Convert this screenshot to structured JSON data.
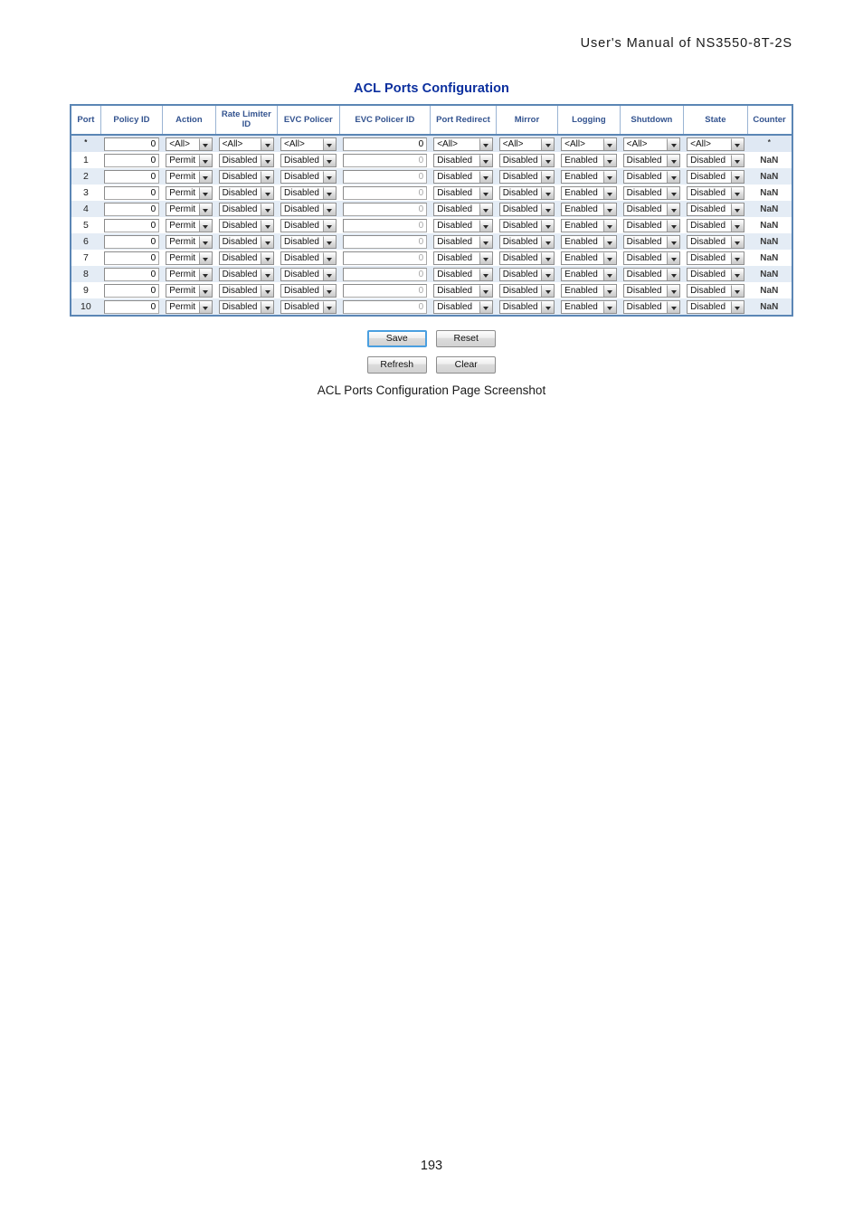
{
  "document": {
    "running_header": "User's Manual of NS3550-8T-2S",
    "page_number": "193"
  },
  "screenshot": {
    "title": "ACL Ports Configuration",
    "caption": "ACL Ports Configuration Page Screenshot",
    "colors": {
      "title_blue": "#0b2f9e",
      "table_border_blue": "#5b86b5",
      "header_text_blue": "#33538f",
      "row_alt_blue": "#e4ecf5",
      "star_row_blue": "#dfe8f3",
      "focus_ring_blue": "#4a9fe0"
    },
    "table": {
      "columns": [
        "Port",
        "Policy ID",
        "Action",
        "Rate Limiter ID",
        "EVC Policer",
        "EVC Policer ID",
        "Port Redirect",
        "Mirror",
        "Logging",
        "Shutdown",
        "State",
        "Counter"
      ],
      "rows": [
        {
          "port": "*",
          "policy_id": "0",
          "action": "<All>",
          "rate_limiter_id": "<All>",
          "evc_policer": "<All>",
          "evc_policer_id": "0",
          "port_redirect": "<All>",
          "mirror": "<All>",
          "logging": "<All>",
          "shutdown": "<All>",
          "state": "<All>",
          "counter": "*"
        },
        {
          "port": "1",
          "policy_id": "0",
          "action": "Permit",
          "rate_limiter_id": "Disabled",
          "evc_policer": "Disabled",
          "evc_policer_id": "0",
          "port_redirect": "Disabled",
          "mirror": "Disabled",
          "logging": "Enabled",
          "shutdown": "Disabled",
          "state": "Disabled",
          "counter": "NaN"
        },
        {
          "port": "2",
          "policy_id": "0",
          "action": "Permit",
          "rate_limiter_id": "Disabled",
          "evc_policer": "Disabled",
          "evc_policer_id": "0",
          "port_redirect": "Disabled",
          "mirror": "Disabled",
          "logging": "Enabled",
          "shutdown": "Disabled",
          "state": "Disabled",
          "counter": "NaN"
        },
        {
          "port": "3",
          "policy_id": "0",
          "action": "Permit",
          "rate_limiter_id": "Disabled",
          "evc_policer": "Disabled",
          "evc_policer_id": "0",
          "port_redirect": "Disabled",
          "mirror": "Disabled",
          "logging": "Enabled",
          "shutdown": "Disabled",
          "state": "Disabled",
          "counter": "NaN"
        },
        {
          "port": "4",
          "policy_id": "0",
          "action": "Permit",
          "rate_limiter_id": "Disabled",
          "evc_policer": "Disabled",
          "evc_policer_id": "0",
          "port_redirect": "Disabled",
          "mirror": "Disabled",
          "logging": "Enabled",
          "shutdown": "Disabled",
          "state": "Disabled",
          "counter": "NaN"
        },
        {
          "port": "5",
          "policy_id": "0",
          "action": "Permit",
          "rate_limiter_id": "Disabled",
          "evc_policer": "Disabled",
          "evc_policer_id": "0",
          "port_redirect": "Disabled",
          "mirror": "Disabled",
          "logging": "Enabled",
          "shutdown": "Disabled",
          "state": "Disabled",
          "counter": "NaN"
        },
        {
          "port": "6",
          "policy_id": "0",
          "action": "Permit",
          "rate_limiter_id": "Disabled",
          "evc_policer": "Disabled",
          "evc_policer_id": "0",
          "port_redirect": "Disabled",
          "mirror": "Disabled",
          "logging": "Enabled",
          "shutdown": "Disabled",
          "state": "Disabled",
          "counter": "NaN"
        },
        {
          "port": "7",
          "policy_id": "0",
          "action": "Permit",
          "rate_limiter_id": "Disabled",
          "evc_policer": "Disabled",
          "evc_policer_id": "0",
          "port_redirect": "Disabled",
          "mirror": "Disabled",
          "logging": "Enabled",
          "shutdown": "Disabled",
          "state": "Disabled",
          "counter": "NaN"
        },
        {
          "port": "8",
          "policy_id": "0",
          "action": "Permit",
          "rate_limiter_id": "Disabled",
          "evc_policer": "Disabled",
          "evc_policer_id": "0",
          "port_redirect": "Disabled",
          "mirror": "Disabled",
          "logging": "Enabled",
          "shutdown": "Disabled",
          "state": "Disabled",
          "counter": "NaN"
        },
        {
          "port": "9",
          "policy_id": "0",
          "action": "Permit",
          "rate_limiter_id": "Disabled",
          "evc_policer": "Disabled",
          "evc_policer_id": "0",
          "port_redirect": "Disabled",
          "mirror": "Disabled",
          "logging": "Enabled",
          "shutdown": "Disabled",
          "state": "Disabled",
          "counter": "NaN"
        },
        {
          "port": "10",
          "policy_id": "0",
          "action": "Permit",
          "rate_limiter_id": "Disabled",
          "evc_policer": "Disabled",
          "evc_policer_id": "0",
          "port_redirect": "Disabled",
          "mirror": "Disabled",
          "logging": "Enabled",
          "shutdown": "Disabled",
          "state": "Disabled",
          "counter": "NaN"
        }
      ]
    },
    "buttons": {
      "save": "Save",
      "reset": "Reset",
      "refresh": "Refresh",
      "clear": "Clear"
    }
  }
}
